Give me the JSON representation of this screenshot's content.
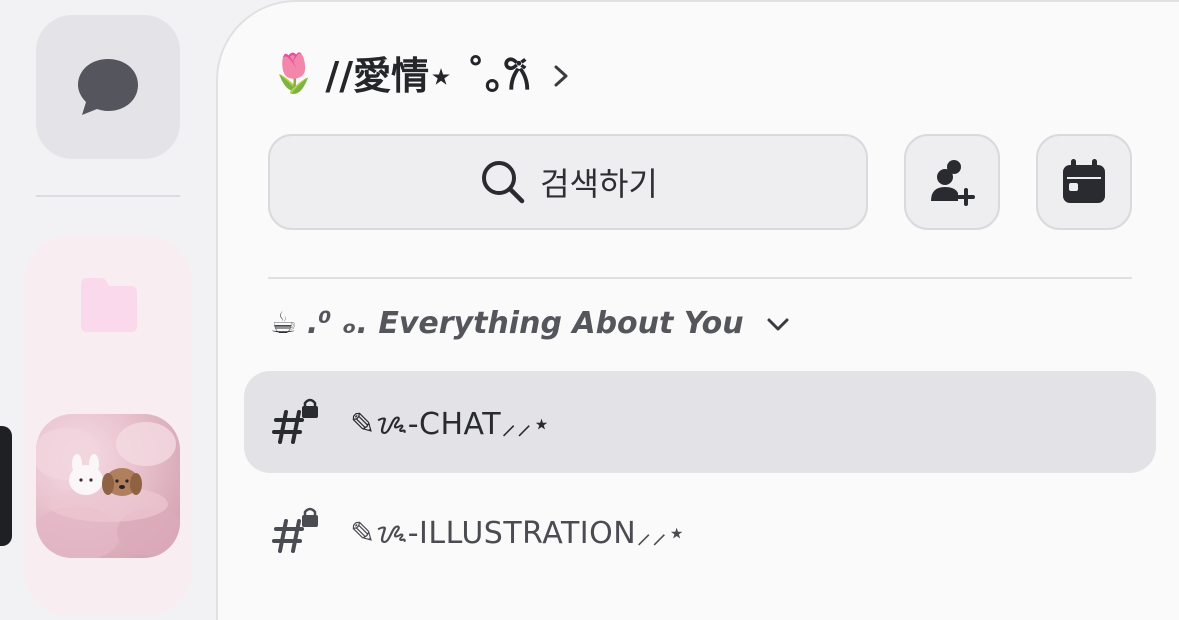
{
  "rail": {
    "dm_icon": "chat-bubble-icon",
    "folder_icon": "folder-icon",
    "server_avatar": "bunny-and-puppy-avatar"
  },
  "server": {
    "emoji": "🌷",
    "name": "//愛情⋆ ˚｡𐙚",
    "chevron_icon": "chevron-right-icon"
  },
  "search": {
    "label": "검색하기",
    "icon": "search-icon"
  },
  "actions": {
    "invite_icon": "add-member-icon",
    "events_icon": "calendar-icon"
  },
  "category": {
    "emoji": "☕",
    "label": " .⁰ ₒ. Everything About You",
    "chevron_icon": "chevron-down-icon"
  },
  "channels": [
    {
      "name": "✎ᝰ-CHAT⸝⸝⋆",
      "icon": "locked-hashtag-icon",
      "selected": true
    },
    {
      "name": "✎ᝰ-ILLUSTRATION⸝⸝⋆",
      "icon": "locked-hashtag-icon",
      "selected": false
    }
  ],
  "colors": {
    "accent_dark": "#1f2024",
    "panel_bg": "#fafafb",
    "rail_bg": "#f2f2f4",
    "folder_pink": "#fbd9ec"
  }
}
